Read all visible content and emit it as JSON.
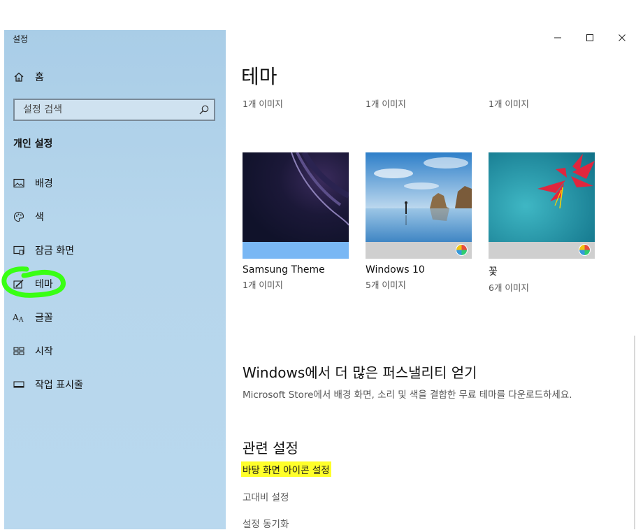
{
  "window": {
    "title": "설정",
    "minimize_label": "minimize",
    "maximize_label": "maximize",
    "close_label": "close"
  },
  "sidebar": {
    "home_label": "홈",
    "search_placeholder": "설정 검색",
    "section_title": "개인 설정",
    "items": [
      {
        "label": "배경",
        "icon": "picture-icon"
      },
      {
        "label": "색",
        "icon": "palette-icon"
      },
      {
        "label": "잠금 화면",
        "icon": "lock-screen-icon"
      },
      {
        "label": "테마",
        "icon": "theme-brush-icon"
      },
      {
        "label": "글꼴",
        "icon": "font-icon"
      },
      {
        "label": "시작",
        "icon": "start-grid-icon"
      },
      {
        "label": "작업 표시줄",
        "icon": "taskbar-icon"
      }
    ],
    "highlight_color": "#39ff14",
    "selected_item": "테마"
  },
  "main": {
    "title": "테마",
    "top_captions": [
      "1개 이미지",
      "1개 이미지",
      "1개 이미지"
    ],
    "themes": [
      {
        "name": "Samsung Theme",
        "count": "1개 이미지"
      },
      {
        "name": "Windows 10",
        "count": "5개 이미지"
      },
      {
        "name": "꽃",
        "count": "6개 이미지"
      }
    ],
    "more_heading": "Windows에서 더 많은 퍼스낼리티 얻기",
    "more_desc": "Microsoft Store에서 배경 화면, 소리 및 색을 결합한 무료 테마를 다운로드하세요.",
    "related_heading": "관련 설정",
    "related_links": [
      "바탕 화면 아이콘 설정",
      "고대비 설정",
      "설정 동기화"
    ],
    "link_highlight_color": "#ffff2a"
  }
}
